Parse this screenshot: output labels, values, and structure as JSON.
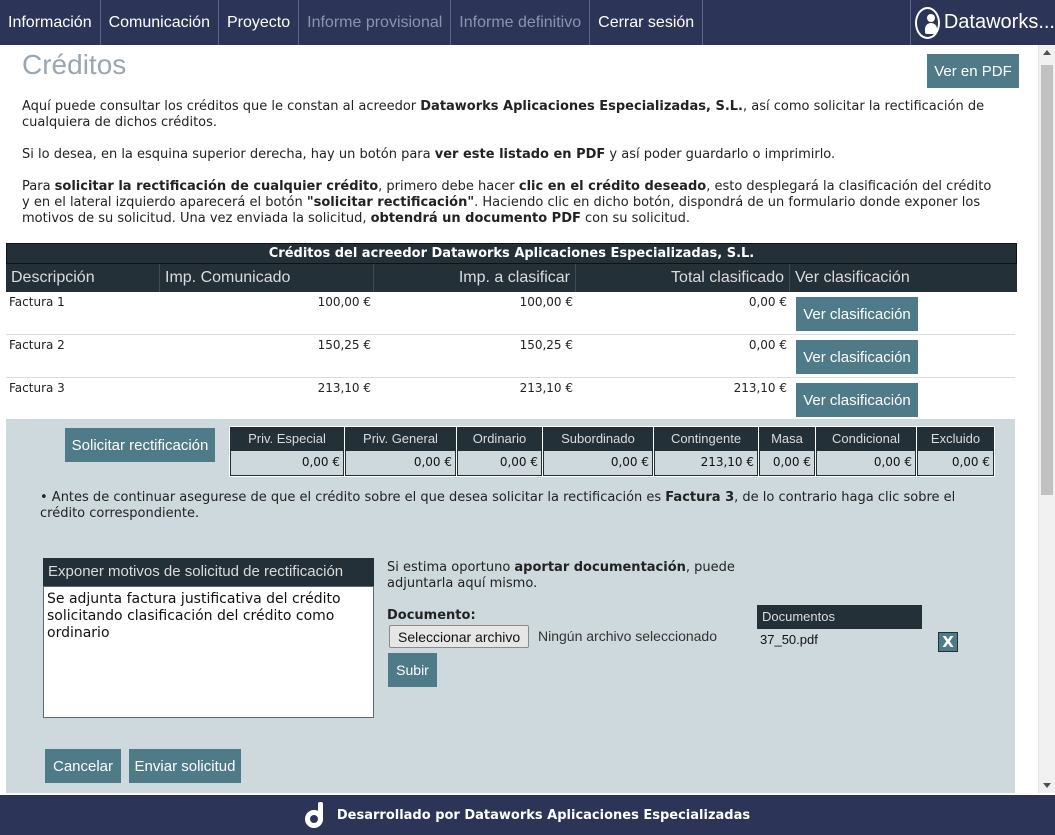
{
  "nav": {
    "items": [
      {
        "label": "Información"
      },
      {
        "label": "Comunicación"
      },
      {
        "label": "Proyecto"
      },
      {
        "label": "Informe provisional"
      },
      {
        "label": "Informe definitivo"
      },
      {
        "label": "Cerrar sesión"
      }
    ],
    "brand": "Dataworks..."
  },
  "page": {
    "title": "Créditos",
    "pdf_button": "Ver en PDF",
    "intro1_a": "Aquí puede consultar los créditos que le constan al acreedor ",
    "intro1_b": "Dataworks Aplicaciones Especializadas, S.L.",
    "intro1_c": ", así como solicitar la rectificación de cualquiera de dichos créditos.",
    "intro2_a": "Si lo desea, en la esquina superior derecha, hay un botón para ",
    "intro2_b": "ver este listado en PDF",
    "intro2_c": " y así poder guardarlo o imprimirlo.",
    "intro3_a": "Para ",
    "intro3_b": "solicitar la rectificación de cualquier crédito",
    "intro3_c": ", primero debe hacer ",
    "intro3_d": "clic en el crédito deseado",
    "intro3_e": ", esto desplegará la clasificación del crédito y en el lateral izquierdo aparecerá el botón ",
    "intro3_f": "\"solicitar rectificación\"",
    "intro3_g": ". Haciendo clic en dicho botón, dispondrá de un formulario donde exponer los motivos de su solicitud. Una vez enviada la solicitud, ",
    "intro3_h": "obtendrá un documento PDF",
    "intro3_i": " con su solicitud."
  },
  "table": {
    "caption": "Créditos del acreedor Dataworks Aplicaciones Especializadas, S.L.",
    "headers": {
      "descripcion": "Descripción",
      "comunicado": "Imp. Comunicado",
      "clasificar": "Imp. a clasificar",
      "total": "Total clasificado",
      "ver": "Ver clasificación"
    },
    "rows": [
      {
        "descripcion": "Factura 1",
        "comunicado": "100,00 €",
        "clasificar": "100,00 €",
        "total": "0,00 €",
        "button": "Ver clasificación"
      },
      {
        "descripcion": "Factura 2",
        "comunicado": "150,25 €",
        "clasificar": "150,25 €",
        "total": "0,00 €",
        "button": "Ver clasificación"
      },
      {
        "descripcion": "Factura 3",
        "comunicado": "213,10 €",
        "clasificar": "213,10 €",
        "total": "213,10 €",
        "button": "Ver clasificación"
      }
    ]
  },
  "panel": {
    "solicitar_button": "Solicitar rectificación",
    "classification": [
      {
        "label": "Priv. Especial",
        "value": "0,00 €"
      },
      {
        "label": "Priv. General",
        "value": "0,00 €"
      },
      {
        "label": "Ordinario",
        "value": "0,00 €"
      },
      {
        "label": "Subordinado",
        "value": "0,00 €"
      },
      {
        "label": "Contingente",
        "value": "213,10 €"
      },
      {
        "label": "Masa",
        "value": "0,00 €"
      },
      {
        "label": "Condicional",
        "value": "0,00 €"
      },
      {
        "label": "Excluido",
        "value": "0,00 €"
      }
    ],
    "warning_bullet": "•",
    "warning_a": " Antes de continuar asegurese de que el crédito sobre el que desea solicitar la rectificación es ",
    "warning_b": "Factura 3",
    "warning_c": ", de lo contrario haga clic sobre el crédito correspondiente.",
    "motivos_header": "Exponer motivos de solicitud de rectificación",
    "motivos_value": "Se adjunta factura justificativa del crédito solicitando clasificación del crédito como ordinario",
    "doc_note_a": "Si estima oportuno ",
    "doc_note_b": "aportar documentación",
    "doc_note_c": ", puede adjuntarla aquí mismo.",
    "document_label": "Documento:",
    "file_button": "Seleccionar archivo",
    "file_status": "Ningún archivo seleccionado",
    "subir_button": "Subir",
    "documents_header": "Documentos",
    "document_file": "37_50.pdf",
    "delete_label": "X",
    "cancel_button": "Cancelar",
    "send_button": "Enviar solicitud"
  },
  "footer": {
    "text": "Desarrollado por Dataworks Aplicaciones Especializadas"
  },
  "colors": {
    "nav_bg": "#2c3557",
    "accent": "#4f7a87",
    "dark_header": "#233038",
    "panel_bg": "#ced9de"
  }
}
